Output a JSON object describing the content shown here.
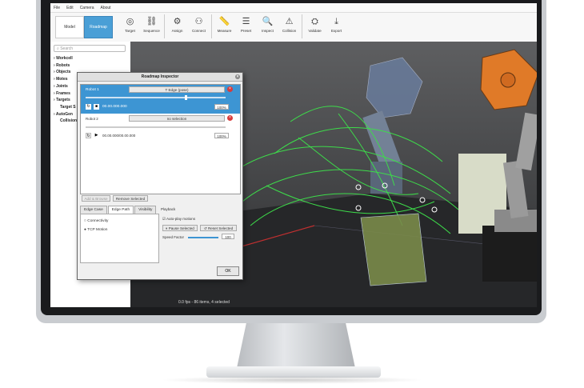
{
  "menu": [
    "File",
    "Edit",
    "Camera",
    "About"
  ],
  "mode_tabs": {
    "model": "Model",
    "roadmap": "Roadmap"
  },
  "tools": [
    {
      "label": "Target",
      "icon": "target-icon",
      "glyph": "◎"
    },
    {
      "label": "Sequence",
      "icon": "sequence-icon",
      "glyph": "⛓"
    },
    {
      "label": "Assign",
      "icon": "assign-icon",
      "glyph": "⚙"
    },
    {
      "label": "Connect",
      "icon": "connect-icon",
      "glyph": "⚇"
    },
    {
      "label": "Measure",
      "icon": "measure-icon",
      "glyph": "📏"
    },
    {
      "label": "Preset",
      "icon": "preset-icon",
      "glyph": "☰"
    },
    {
      "label": "Inspect",
      "icon": "inspect-icon",
      "glyph": "🔍"
    },
    {
      "label": "Collision",
      "icon": "collision-icon",
      "glyph": "⚠"
    },
    {
      "label": "Validate",
      "icon": "validate-icon",
      "glyph": "⛭"
    },
    {
      "label": "Export",
      "icon": "export-icon",
      "glyph": "⤓"
    }
  ],
  "sidebar": {
    "search_placeholder": "Search",
    "items": [
      "Workcell",
      "Robots",
      "Objects",
      "Motes",
      "Joints",
      "Frames",
      "Targets",
      "Target S",
      "AutoGen",
      "Collision"
    ]
  },
  "dialog": {
    "title": "Roadmap Inspector",
    "robot1": {
      "label": "Robot 1",
      "value": "T Edge (pose)",
      "time": "00.00.000.000",
      "speed": "100%"
    },
    "robot2": {
      "label": "Robot 2",
      "value": "no selection",
      "time": "00.00.000/00.00.000",
      "speed": "100%"
    },
    "buttons": {
      "add": "Add & Browse",
      "remove": "Remove Selected"
    },
    "tabs": [
      "Edge Case",
      "Edge Path",
      "Visibility"
    ],
    "radios": [
      "Connectivity",
      "TCP Motion"
    ],
    "playback": {
      "title": "Playback",
      "autoplay": "Auto-play motions",
      "pause": "Pause Selected",
      "reset": "Reset Selected",
      "speed_label": "Speed Factor",
      "speed_value": "100",
      "speed_fraction": 1.0
    },
    "ok": "OK"
  },
  "viewport_status": "0.0 fps - 86 items, 4 selected",
  "colors": {
    "accent": "#3d95d3",
    "path_green": "#3ddc4a",
    "robot_orange": "#e07a28"
  }
}
